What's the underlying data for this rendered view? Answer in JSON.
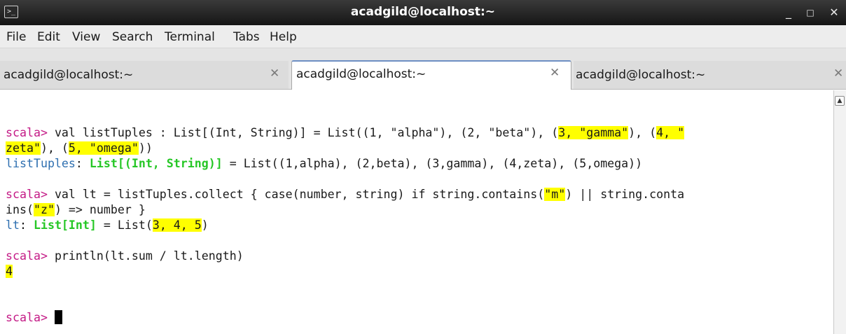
{
  "window": {
    "title": "acadgild@localhost:~",
    "icon": "terminal-icon",
    "controls": {
      "minimize": "_",
      "maximize": "□",
      "close": "✕"
    }
  },
  "menu": {
    "items": [
      "File",
      "Edit",
      "View",
      "Search",
      "Terminal",
      "Tabs",
      "Help"
    ]
  },
  "tabs": [
    {
      "label": "acadgild@localhost:~",
      "close": "✕",
      "active": false
    },
    {
      "label": "acadgild@localhost:~",
      "close": "✕",
      "active": true
    },
    {
      "label": "acadgild@localhost:~",
      "close": "✕",
      "active": false
    }
  ],
  "terminal": {
    "prompt": "scala>",
    "l1": {
      "a": " val listTuples : List[(Int, String)] = List((1, \"alpha\"), (2, \"beta\"), (",
      "b": "3, \"gamma\"",
      "c": "), (",
      "d": "4, \""
    },
    "l2": {
      "a": "zeta\"",
      "b": "), (",
      "c": "5, \"omega\"",
      "d": "))"
    },
    "l3": {
      "ident": "listTuples",
      "colon": ": ",
      "type": "List[(Int, String)]",
      "rest": " = List((1,alpha), (2,beta), (3,gamma), (4,zeta), (5,omega))"
    },
    "l4": {
      "a": " val lt = listTuples.collect { case(number, string) if string.contains(",
      "b": "\"m\"",
      "c": ") || string.conta"
    },
    "l5": {
      "a": "ins(",
      "b": "\"z\"",
      "c": ") => number }"
    },
    "l6": {
      "ident": "lt",
      "colon": ": ",
      "type": "List[Int]",
      "a": " = List(",
      "b": "3, 4, 5",
      "c": ")"
    },
    "l7": {
      "a": " println(lt.sum / lt.length)"
    },
    "l8": {
      "result": "4"
    },
    "l9": {
      "a": " "
    }
  },
  "colors": {
    "prompt": "#c41a86",
    "identifier": "#2e6fb0",
    "type": "#26c726",
    "highlight": "#ffff00"
  }
}
